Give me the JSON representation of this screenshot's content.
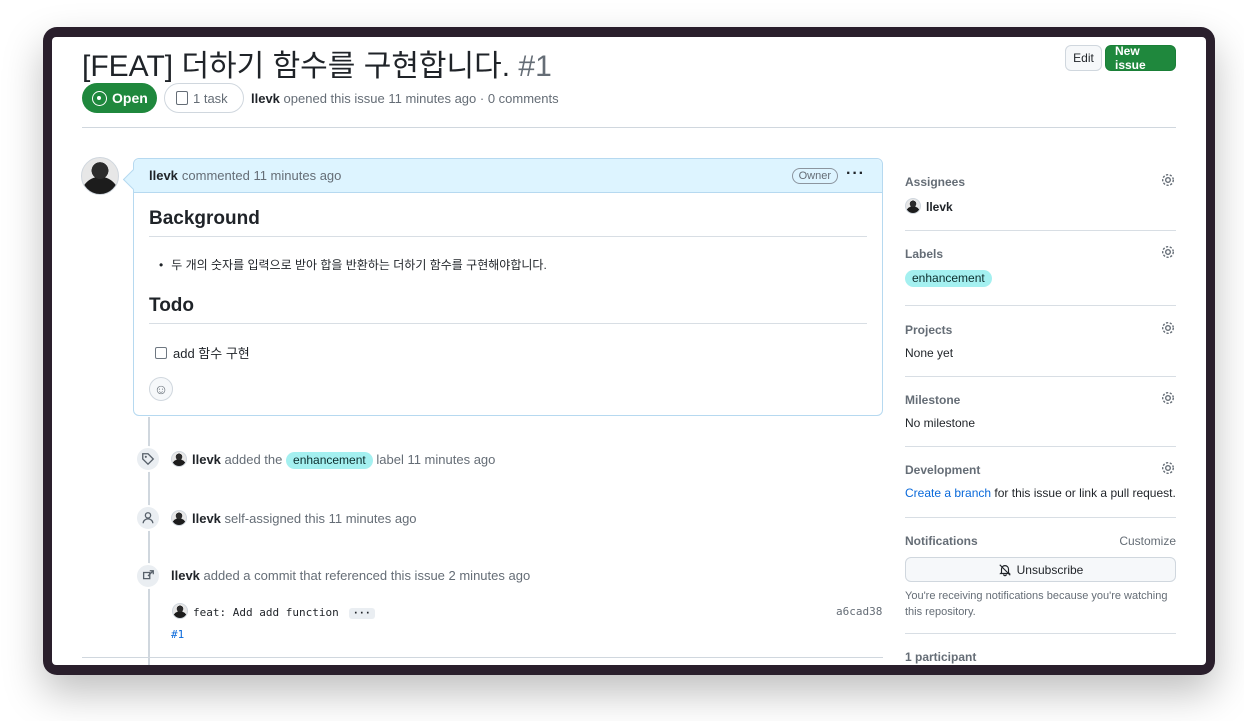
{
  "issue": {
    "title": "[FEAT] 더하기 함수를 구현합니다.",
    "number": "#1",
    "state": "Open",
    "tasks": "1 task",
    "author": "llevk",
    "opened_meta": "opened this issue 11 minutes ago · 0 comments"
  },
  "header_buttons": {
    "edit": "Edit",
    "new_issue": "New issue"
  },
  "comment": {
    "author": "llevk",
    "time": "commented 11 minutes ago",
    "role": "Owner",
    "menu": "···",
    "heading1": "Background",
    "bullet": "두 개의 숫자를 입력으로 받아 합을 반환하는 더하기 함수를 구현해야합니다.",
    "heading2": "Todo",
    "task": "add 함수 구현"
  },
  "timeline": [
    {
      "icon": "tag-icon",
      "author": "llevk",
      "pre": "added the",
      "label": "enhancement",
      "post": "label 11 minutes ago"
    },
    {
      "icon": "person-icon",
      "author": "llevk",
      "text": "self-assigned this 11 minutes ago"
    },
    {
      "icon": "cross-reference-icon",
      "author": "llevk",
      "text": "added a commit that referenced this issue 2 minutes ago"
    }
  ],
  "commit": {
    "message": "feat: Add add function",
    "ellipsis": "···",
    "sha": "a6cad38",
    "ref": "#1"
  },
  "sidebar": {
    "assignees": {
      "title": "Assignees",
      "value": "llevk"
    },
    "labels": {
      "title": "Labels",
      "value": "enhancement"
    },
    "projects": {
      "title": "Projects",
      "value": "None yet"
    },
    "milestone": {
      "title": "Milestone",
      "value": "No milestone"
    },
    "development": {
      "title": "Development",
      "link": "Create a branch",
      "rest": " for this issue or link a pull request."
    },
    "notifications": {
      "title": "Notifications",
      "customize": "Customize",
      "button": "Unsubscribe",
      "note": "You're receiving notifications because you're watching this repository."
    },
    "participants": {
      "title": "1 participant"
    }
  },
  "colors": {
    "open_green": "#1f883d",
    "label_bg": "#a4f0f0",
    "link": "#0969da",
    "comment_header": "#ddf4ff"
  }
}
